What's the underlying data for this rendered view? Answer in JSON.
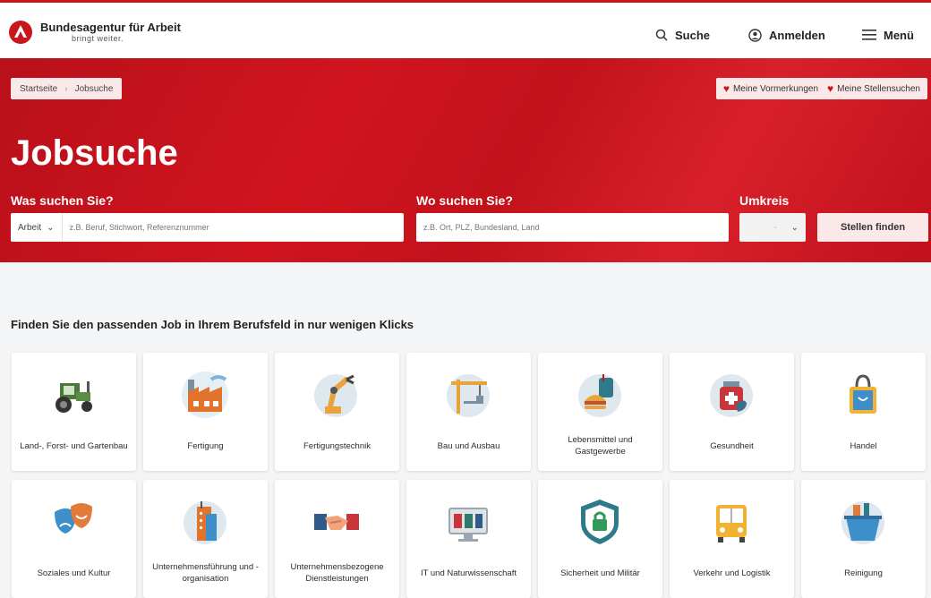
{
  "header": {
    "brand_name": "Bundesagentur für Arbeit",
    "brand_tagline": "bringt weiter.",
    "search_label": "Suche",
    "login_label": "Anmelden",
    "menu_label": "Menü"
  },
  "hero": {
    "breadcrumb": [
      "Startseite",
      "Jobsuche"
    ],
    "saved_jobs_label": "Meine Vormerkungen",
    "saved_searches_label": "Meine Stellensuchen",
    "title": "Jobsuche",
    "what_label": "Was suchen Sie?",
    "what_type": "Arbeit",
    "what_placeholder": "z.B. Beruf, Stichwort, Referenznummer",
    "where_label": "Wo suchen Sie?",
    "where_placeholder": "z.B. Ort, PLZ, Bundesland, Land",
    "radius_label": "Umkreis",
    "radius_value": "-",
    "find_button": "Stellen finden"
  },
  "categories_heading": "Finden Sie den passenden Job in Ihrem Berufsfeld in nur wenigen Klicks",
  "categories": [
    {
      "label": "Land-, Forst- und Gartenbau",
      "icon": "tractor-icon"
    },
    {
      "label": "Fertigung",
      "icon": "factory-icon"
    },
    {
      "label": "Fertigungstechnik",
      "icon": "robot-arm-icon"
    },
    {
      "label": "Bau und Ausbau",
      "icon": "crane-icon"
    },
    {
      "label": "Lebensmittel und Gastgewerbe",
      "icon": "food-icon"
    },
    {
      "label": "Gesundheit",
      "icon": "medicine-icon"
    },
    {
      "label": "Handel",
      "icon": "shopping-bag-icon"
    },
    {
      "label": "Soziales und Kultur",
      "icon": "theater-masks-icon"
    },
    {
      "label": "Unternehmensführung und -organisation",
      "icon": "office-building-icon"
    },
    {
      "label": "Unternehmensbezogene Dienstleistungen",
      "icon": "handshake-icon"
    },
    {
      "label": "IT und Naturwissenschaft",
      "icon": "monitor-icon"
    },
    {
      "label": "Sicherheit und Militär",
      "icon": "shield-lock-icon"
    },
    {
      "label": "Verkehr und Logistik",
      "icon": "bus-icon"
    },
    {
      "label": "Reinigung",
      "icon": "cleaning-bucket-icon"
    }
  ],
  "colors": {
    "brand_red": "#c8161d",
    "card_bg": "#ffffff",
    "page_bg": "#f4f5f6"
  }
}
